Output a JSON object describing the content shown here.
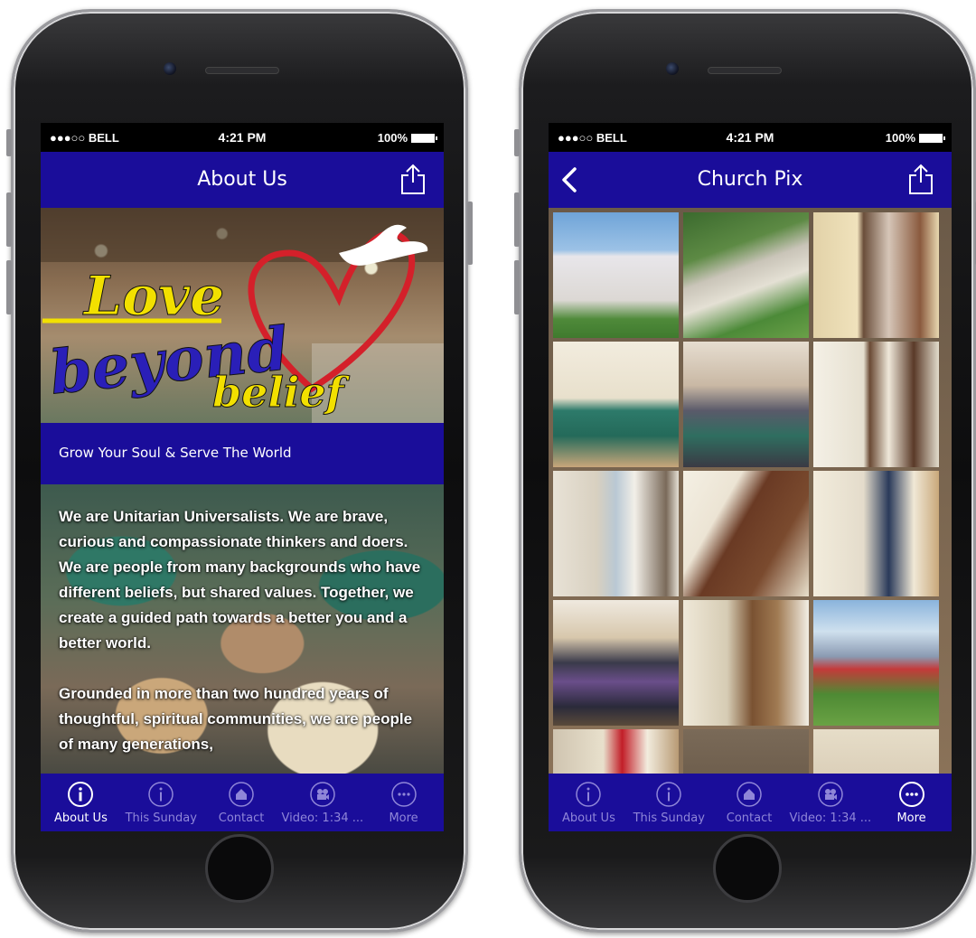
{
  "status": {
    "carrier": "●●●○○ BELL",
    "time": "4:21 PM",
    "battery": "100%"
  },
  "screen_a": {
    "nav_title": "About Us",
    "hero_logo_text": [
      "Love",
      "beyond",
      "belief"
    ],
    "tagline": "Grow Your Soul & Serve The World",
    "paragraphs": [
      "We are Unitarian Universalists. We are brave, curious and compassionate thinkers and doers. We are people from many backgrounds who have different beliefs, but shared values. Together, we create a guided path towards a better you and a better world.",
      "Grounded in more than two hundred years of thoughtful, spiritual communities, we are people of many generations,"
    ]
  },
  "screen_b": {
    "nav_title": "Church Pix"
  },
  "tabs": [
    {
      "label": "About Us",
      "icon": "info-icon"
    },
    {
      "label": "This Sunday",
      "icon": "info-icon"
    },
    {
      "label": "Contact",
      "icon": "home-icon"
    },
    {
      "label": "Video: 1:34 ...",
      "icon": "video-camera-icon"
    },
    {
      "label": "More",
      "icon": "more-icon"
    }
  ],
  "colors": {
    "brand": "#1a0d9a",
    "tab_inactive": "#8f86d8",
    "logo_yellow": "#f2e000",
    "logo_blue": "#2a1fb8",
    "logo_red": "#d4202a"
  }
}
